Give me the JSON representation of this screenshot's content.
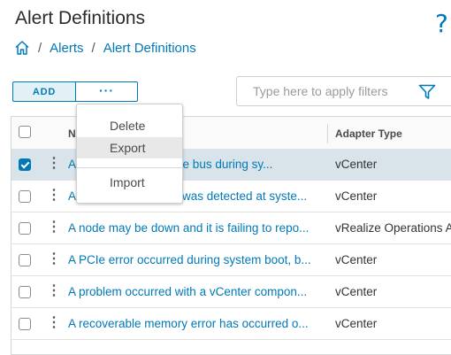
{
  "page": {
    "title": "Alert Definitions",
    "help_glyph": "?"
  },
  "breadcrumb": {
    "items": [
      "Alerts",
      "Alert Definitions"
    ],
    "separator": "/"
  },
  "toolbar": {
    "add_label": "ADD",
    "more_label": "···"
  },
  "filter": {
    "placeholder": "Type here to apply filters",
    "value": ""
  },
  "grid": {
    "columns": {
      "name": "N",
      "adapter": "Adapter Type"
    },
    "rows": [
      {
        "name": "A PCIe error occurred on a PCIe bus during sy...",
        "name_visible": "A",
        "name_tail": "on a PCIe bus during sy...",
        "adapter": "vCenter",
        "selected": true
      },
      {
        "name_visible": "A",
        "name_tail": "was detected at syste...",
        "adapter": "vCenter",
        "selected": false
      },
      {
        "name_visible": "A node may be down and it is failing to repo...",
        "adapter": "vRealize Operations A",
        "selected": false
      },
      {
        "name_visible": "A PCIe error occurred during system boot, b...",
        "adapter": "vCenter",
        "selected": false
      },
      {
        "name_visible": "A problem occurred with a vCenter compon...",
        "adapter": "vCenter",
        "selected": false
      },
      {
        "name_visible": "A recoverable memory error has occurred o...",
        "adapter": "vCenter",
        "selected": false
      }
    ]
  },
  "menu": {
    "items": [
      "Delete",
      "Export",
      "Import"
    ],
    "hovered": "Export"
  },
  "colors": {
    "accent": "#0079b8",
    "selected_row": "#d8e3ea",
    "add_bg": "#e1f1f6"
  },
  "icons": {
    "home": "home-icon",
    "filter": "filter-funnel-icon",
    "help": "help-icon",
    "row_actions": "kebab-vertical-icon"
  }
}
